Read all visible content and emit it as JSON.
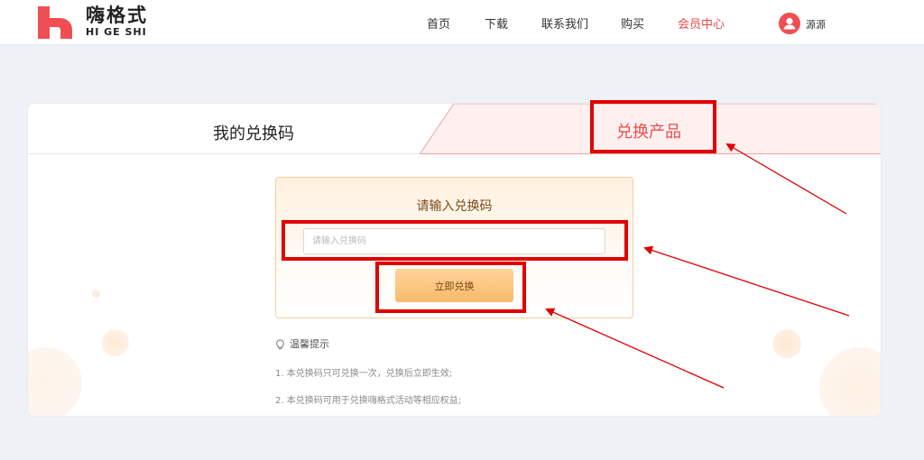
{
  "header": {
    "logo_cn": "嗨格式",
    "logo_en": "HI GE SHI",
    "nav": [
      {
        "label": "首页"
      },
      {
        "label": "下载"
      },
      {
        "label": "联系我们"
      },
      {
        "label": "购买"
      },
      {
        "label": "会员中心",
        "active": true
      }
    ],
    "username": "源源"
  },
  "tabs": {
    "my_codes": "我的兑换码",
    "redeem_product": "兑换产品"
  },
  "redeem": {
    "title": "请输入兑换码",
    "input_placeholder": "请输入兑换码",
    "input_value": "",
    "button_label": "立即兑换"
  },
  "tips": {
    "heading": "温馨提示",
    "items": [
      "1. 本兑换码只可兑换一次，兑换后立即生效;",
      "2. 本兑换码可用于兑换嗨格式活动等相应权益;"
    ]
  },
  "colors": {
    "brand": "#ef4f52",
    "accent_orange": "#f7ba6a",
    "annotation_red": "#e00000"
  }
}
